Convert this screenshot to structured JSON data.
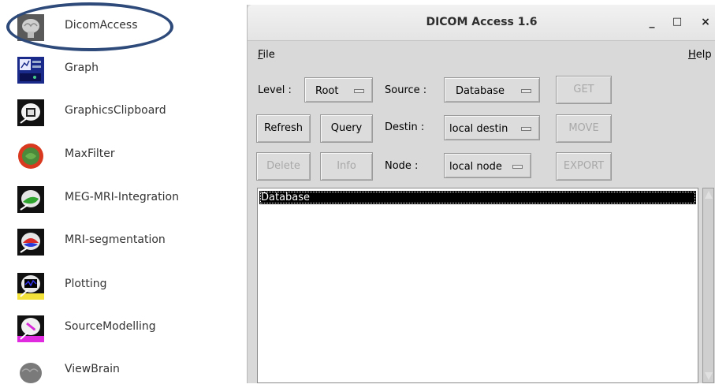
{
  "launcher": {
    "items": [
      {
        "label": "DicomAccess",
        "icon": "brain-dicom-icon"
      },
      {
        "label": "Graph",
        "icon": "graph-icon"
      },
      {
        "label": "GraphicsClipboard",
        "icon": "graphics-clipboard-icon"
      },
      {
        "label": "MaxFilter",
        "icon": "maxfilter-icon"
      },
      {
        "label": "MEG-MRI-Integration",
        "icon": "meg-mri-icon"
      },
      {
        "label": "MRI-segmentation",
        "icon": "mri-segmentation-icon"
      },
      {
        "label": "Plotting",
        "icon": "plotting-icon"
      },
      {
        "label": "SourceModelling",
        "icon": "source-modelling-icon"
      },
      {
        "label": "ViewBrain",
        "icon": "view-brain-icon"
      }
    ],
    "highlight_color": "#2e4a7a"
  },
  "window": {
    "title": "DICOM Access 1.6",
    "minimize": "_",
    "maximize": "□",
    "close": "×"
  },
  "menu": {
    "file": "File",
    "help": "Help"
  },
  "form": {
    "level_label": "Level :",
    "level_value": "Root",
    "source_label": "Source :",
    "source_value": "Database",
    "destin_label": "Destin :",
    "destin_value": "local destin",
    "node_label": "Node :",
    "node_value": "local node"
  },
  "buttons": {
    "get": "GET",
    "move": "MOVE",
    "export": "EXPORT",
    "refresh": "Refresh",
    "query": "Query",
    "delete": "Delete",
    "info": "Info"
  },
  "list": {
    "items": [
      "Database"
    ]
  }
}
